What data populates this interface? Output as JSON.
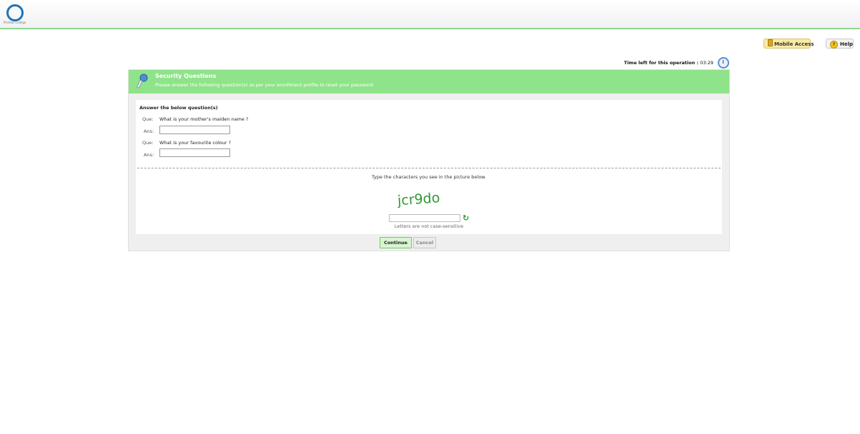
{
  "header": {
    "logo_text": "Pinellas College",
    "mobile_access_label": "Mobile Access",
    "help_label": "Help"
  },
  "timer": {
    "label": "Time left for this operation :",
    "value": "03:29"
  },
  "panel": {
    "title": "Security Questions",
    "subtitle": "Please answer the following question(s) as per your enrollment profile to reset your password",
    "section_title": "Answer the below question(s)",
    "questions": [
      {
        "que_label": "Que:",
        "question": "What is your mother's maiden name ?",
        "ans_label": "Ans:",
        "answer": ""
      },
      {
        "que_label": "Que:",
        "question": "What is your favourite colour ?",
        "ans_label": "Ans:",
        "answer": ""
      }
    ],
    "captcha": {
      "prompt": "Type the characters you see in the picture below.",
      "image_text": "jcr9do",
      "input_value": "",
      "note": "Letters are not case-sensitive"
    }
  },
  "buttons": {
    "continue": "Continue",
    "cancel": "Cancel"
  },
  "colors": {
    "header_green": "#8fe38a",
    "captcha_green": "#2e9a2e",
    "logo_blue": "#1d73b9"
  },
  "icons": [
    "logo-ring-icon",
    "phone-icon",
    "help-icon",
    "clock-icon",
    "key-icon",
    "refresh-icon"
  ]
}
